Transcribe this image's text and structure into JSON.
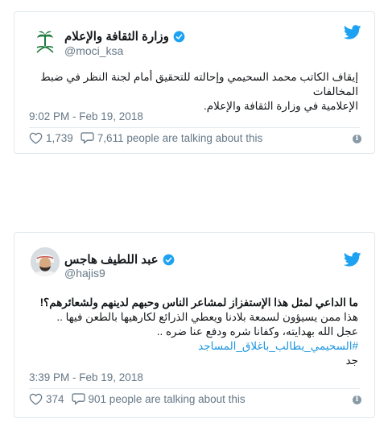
{
  "tweets": [
    {
      "name": "وزارة الثقافة والإعلام",
      "handle": "@moci_ksa",
      "text_lines": [
        "إيقاف الكاتب محمد السحيمي وإحالته للتحقيق أمام لجنة النظر في ضبط المخالفات",
        "الإعلامية في وزارة الثقافة والإعلام."
      ],
      "time": "9:02 PM - Feb 19, 2018",
      "likes": "1,739",
      "talking": "7,611 people are talking about this",
      "avatar_icon": "palm-swords-emblem-icon"
    },
    {
      "name": "عبد اللطيف هاجس",
      "handle": "@hajis9",
      "text_lines": [
        "ما الداعي لمثل هذا الإستفزاز لمشاعر الناس وحبهم لدينهم ولشعائرهم؟!",
        "هذا ممن يسيؤون لسمعة بلادنا ويعطي الذرائع لكارهيها بالطعن فيها ..",
        "عجل الله بهدايته، وكفانا شره ودفع عنا ضره ..",
        "جد"
      ],
      "hashtag": "#السحيمي_يطالب_باغلاق_المساجد",
      "time": "3:39 PM - Feb 19, 2018",
      "likes": "374",
      "talking": "901 people are talking about this",
      "avatar_icon": "user-photo-avatar"
    }
  ],
  "icons": {
    "twitter": "twitter-bird-icon",
    "verified": "verified-badge-icon",
    "like": "heart-icon",
    "reply": "speech-bubble-icon",
    "info": "info-icon"
  },
  "info_glyph": "i",
  "colors": {
    "twitter_blue": "#1da1f2",
    "text": "#14171a",
    "muted": "#657786",
    "border": "#e1e8ed",
    "link": "#1b95e0",
    "emblem_green": "#1e7a3c"
  }
}
